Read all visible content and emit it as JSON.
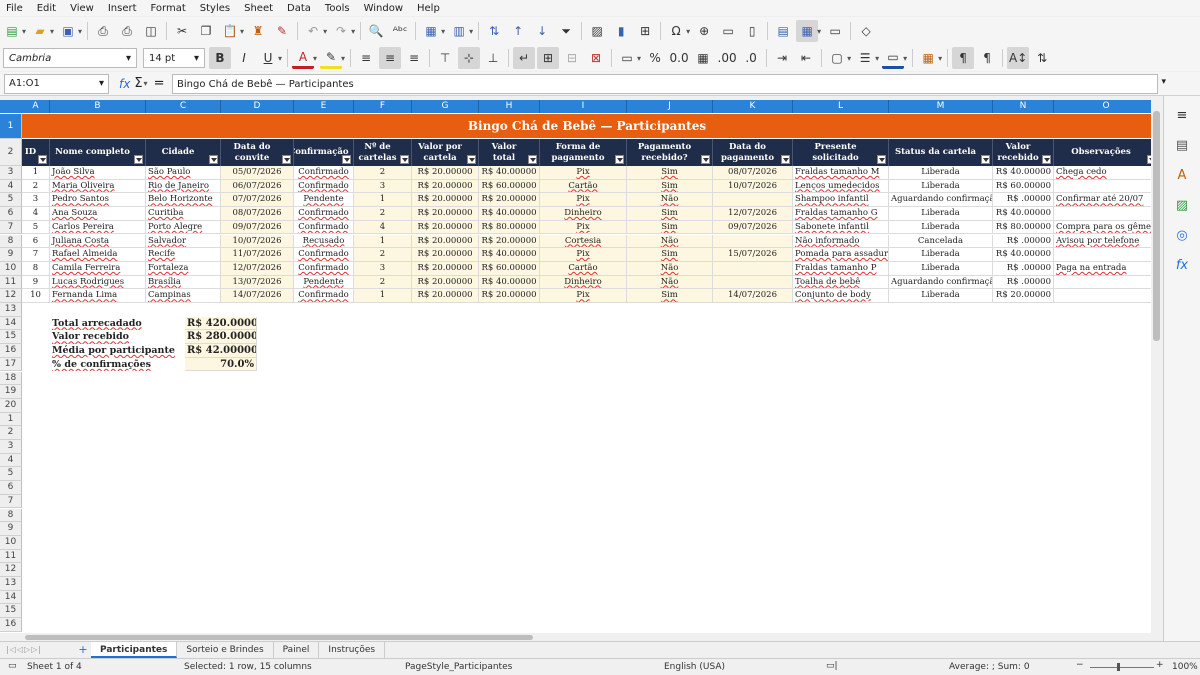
{
  "menu": [
    "File",
    "Edit",
    "View",
    "Insert",
    "Format",
    "Styles",
    "Sheet",
    "Data",
    "Tools",
    "Window",
    "Help"
  ],
  "font": {
    "name": "Cambria",
    "size": "14 pt"
  },
  "namebox": "A1:O1",
  "formula": "Bingo Chá de Bebê — Participantes",
  "columns": [
    "A",
    "B",
    "C",
    "D",
    "E",
    "F",
    "G",
    "H",
    "I",
    "J",
    "K",
    "L",
    "M",
    "N",
    "O"
  ],
  "rows": [
    "1",
    "2",
    "3",
    "4",
    "5",
    "6",
    "7",
    "8",
    "9",
    "10",
    "11",
    "12",
    "13",
    "14",
    "15",
    "16",
    "17",
    "18",
    "19",
    "20",
    "1",
    "2",
    "3",
    "4",
    "5",
    "6",
    "7",
    "8",
    "9",
    "10",
    "11",
    "12",
    "13",
    "14",
    "15",
    "16"
  ],
  "title": "Bingo Chá de Bebê — Participantes",
  "headers": [
    "ID",
    "Nome completo",
    "Cidade",
    "Data do convite",
    "Confirmação",
    "Nº de cartelas",
    "Valor por cartela",
    "Valor total",
    "Forma de pagamento",
    "Pagamento recebido?",
    "Data do pagamento",
    "Presente solicitado",
    "Status da cartela",
    "Valor recebido",
    "Observações"
  ],
  "data_rows": [
    [
      "1",
      "João Silva",
      "São Paulo",
      "05/07/2026",
      "Confirmado",
      "2",
      "R$ 20.00000",
      "R$ 40.00000",
      "Pix",
      "Sim",
      "08/07/2026",
      "Fraldas tamanho M",
      "Liberada",
      "R$ 40.00000",
      "Chega cedo"
    ],
    [
      "2",
      "Maria Oliveira",
      "Rio de Janeiro",
      "06/07/2026",
      "Confirmado",
      "3",
      "R$ 20.00000",
      "R$ 60.00000",
      "Cartão",
      "Sim",
      "10/07/2026",
      "Lenços umedecidos",
      "Liberada",
      "R$ 60.00000",
      ""
    ],
    [
      "3",
      "Pedro Santos",
      "Belo Horizonte",
      "07/07/2026",
      "Pendente",
      "1",
      "R$ 20.00000",
      "R$ 20.00000",
      "Pix",
      "Não",
      "",
      "Shampoo infantil",
      "Aguardando confirmação",
      "R$ .00000",
      "Confirmar até 20/07"
    ],
    [
      "4",
      "Ana Souza",
      "Curitiba",
      "08/07/2026",
      "Confirmado",
      "2",
      "R$ 20.00000",
      "R$ 40.00000",
      "Dinheiro",
      "Sim",
      "12/07/2026",
      "Fraldas tamanho G",
      "Liberada",
      "R$ 40.00000",
      ""
    ],
    [
      "5",
      "Carlos Pereira",
      "Porto Alegre",
      "09/07/2026",
      "Confirmado",
      "4",
      "R$ 20.00000",
      "R$ 80.00000",
      "Pix",
      "Sim",
      "09/07/2026",
      "Sabonete infantil",
      "Liberada",
      "R$ 80.00000",
      "Compra para os gêmeos"
    ],
    [
      "6",
      "Juliana Costa",
      "Salvador",
      "10/07/2026",
      "Recusado",
      "1",
      "R$ 20.00000",
      "R$ 20.00000",
      "Cortesia",
      "Não",
      "",
      "Não informado",
      "Cancelada",
      "R$ .00000",
      "Avisou por telefone"
    ],
    [
      "7",
      "Rafael Almeida",
      "Recife",
      "11/07/2026",
      "Confirmado",
      "2",
      "R$ 20.00000",
      "R$ 40.00000",
      "Pix",
      "Sim",
      "15/07/2026",
      "Pomada para assaduras",
      "Liberada",
      "R$ 40.00000",
      ""
    ],
    [
      "8",
      "Camila Ferreira",
      "Fortaleza",
      "12/07/2026",
      "Confirmado",
      "3",
      "R$ 20.00000",
      "R$ 60.00000",
      "Cartão",
      "Não",
      "",
      "Fraldas tamanho P",
      "Liberada",
      "R$ .00000",
      "Paga na entrada"
    ],
    [
      "9",
      "Lucas Rodrigues",
      "Brasília",
      "13/07/2026",
      "Pendente",
      "2",
      "R$ 20.00000",
      "R$ 40.00000",
      "Dinheiro",
      "Não",
      "",
      "Toalha de bebê",
      "Aguardando confirmação",
      "R$ .00000",
      ""
    ],
    [
      "10",
      "Fernanda Lima",
      "Campinas",
      "14/07/2026",
      "Confirmado",
      "1",
      "R$ 20.00000",
      "R$ 20.00000",
      "Pix",
      "Sim",
      "14/07/2026",
      "Conjunto de body",
      "Liberada",
      "R$ 20.00000",
      ""
    ]
  ],
  "summary": [
    {
      "label": "Total arrecadado",
      "value": "R$ 420.00000"
    },
    {
      "label": "Valor recebido",
      "value": "R$ 280.00000"
    },
    {
      "label": "Média por participante",
      "value": "R$ 42.00000"
    },
    {
      "label": "% de confirmações",
      "value": "70.0%"
    }
  ],
  "tabs": [
    "Participantes",
    "Sorteio e Brindes",
    "Painel",
    "Instruções"
  ],
  "status": {
    "sheet": "Sheet 1 of 4",
    "selection": "Selected: 1 row, 15 columns",
    "pagestyle": "PageStyle_Participantes",
    "language": "English (USA)",
    "sum": "Average: ; Sum: 0",
    "zoom": "100%"
  }
}
